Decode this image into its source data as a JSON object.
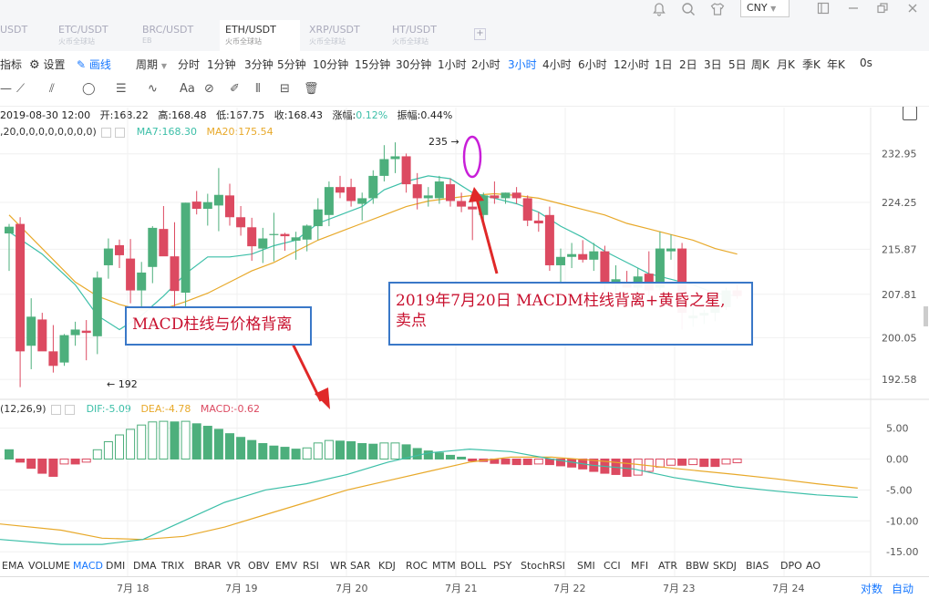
{
  "tabs": [
    {
      "pair": "USDT",
      "sub": "",
      "active": false
    },
    {
      "pair": "ETC/USDT",
      "sub": "火币全球站",
      "active": false
    },
    {
      "pair": "BRC/USDT",
      "sub": "EB",
      "active": false
    },
    {
      "pair": "ETH/USDT",
      "sub": "火币全球站",
      "active": true
    },
    {
      "pair": "XRP/USDT",
      "sub": "火币全球站",
      "active": false
    },
    {
      "pair": "HT/USDT",
      "sub": "火币全球站",
      "active": false
    }
  ],
  "add_tab": "+",
  "currency": "CNY",
  "toolbar": {
    "indicator": "指标",
    "settings": "设置",
    "draw": "画线",
    "period": "周期",
    "intervals": [
      "分时",
      "1分钟",
      "3分钟",
      "5分钟",
      "10分钟",
      "15分钟",
      "30分钟",
      "1小时",
      "2小时",
      "3小时",
      "4小时",
      "6小时",
      "12小时",
      "1日",
      "2日",
      "3日",
      "5日",
      "周K",
      "月K",
      "季K",
      "年K",
      "0s"
    ],
    "active_interval": "3小时"
  },
  "text_tool": "Aa",
  "ohlc": {
    "date": "2019-08-30 12:00",
    "open_label": "开:",
    "open": "168.22",
    "high_label": "高:",
    "high": "168.48",
    "low_label": "低:",
    "low": "167.75",
    "close_label": "收:",
    "close": "168.43",
    "change_label": "涨幅:",
    "change": "0.12%",
    "amp_label": "振幅:",
    "amp": "0.44%"
  },
  "ma_legend": {
    "params": ",20,0,0,0,0,0,0,0,0)",
    "ma7": "MA7:168.30",
    "ma20": "MA20:175.54"
  },
  "macd_legend": {
    "params": "(12,26,9)",
    "dif": "DIF:-5.09",
    "dea": "DEA:-4.78",
    "macd": "MACD:-0.62"
  },
  "indicators": [
    "EMA",
    "VOLUME",
    "MACD",
    "DMI",
    "DMA",
    "TRIX",
    "BRAR",
    "VR",
    "OBV",
    "EMV",
    "RSI",
    "WR",
    "SAR",
    "KDJ",
    "ROC",
    "MTM",
    "BOLL",
    "PSY",
    "StochRSI",
    "SMI",
    "CCI",
    "MFI",
    "ATR",
    "BBW",
    "SKDJ",
    "BIAS",
    "DPO",
    "AO"
  ],
  "active_indicator": "MACD",
  "date_labels": [
    "7月 18",
    "7月 19",
    "7月 20",
    "7月 21",
    "7月 22",
    "7月 23",
    "7月 24"
  ],
  "bottom_right": [
    "对数",
    "自动"
  ],
  "colors": {
    "up": "#4daf7c",
    "down": "#dc4a61",
    "ma7": "#3cbfa8",
    "ma20": "#e8a92a",
    "dif": "#3cbfa8",
    "dea": "#e8a92a",
    "annot": "#c8102e",
    "arrow": "#e02828"
  },
  "chart_data": {
    "type": "candlestick",
    "price_ticks": [
      "232.95",
      "224.25",
      "215.87",
      "207.81",
      "200.05",
      "192.58"
    ],
    "price_ylim": [
      189.5,
      236
    ],
    "macd_ticks": [
      "5.00",
      "0.00",
      "-5.00",
      "-10.00",
      "-15.00"
    ],
    "macd_ylim": [
      -16,
      7
    ],
    "high_marker": "235 →",
    "low_marker": "← 192",
    "candles": [
      {
        "o": 218.7,
        "h": 220.4,
        "l": 212.0,
        "c": 219.9
      },
      {
        "o": 220.4,
        "h": 221.6,
        "l": 191.2,
        "c": 197.6
      },
      {
        "o": 198.6,
        "h": 207.1,
        "l": 194.4,
        "c": 203.8
      },
      {
        "o": 203.3,
        "h": 204.5,
        "l": 197.8,
        "c": 197.6
      },
      {
        "o": 197.6,
        "h": 202.3,
        "l": 193.8,
        "c": 195.0
      },
      {
        "o": 195.6,
        "h": 200.7,
        "l": 195.0,
        "c": 200.5
      },
      {
        "o": 200.5,
        "h": 202.9,
        "l": 198.6,
        "c": 201.5
      },
      {
        "o": 201.3,
        "h": 203.2,
        "l": 196.0,
        "c": 200.9
      },
      {
        "o": 200.3,
        "h": 211.9,
        "l": 197.1,
        "c": 210.8
      },
      {
        "o": 213.0,
        "h": 217.8,
        "l": 210.6,
        "c": 216.0
      },
      {
        "o": 216.6,
        "h": 217.6,
        "l": 212.5,
        "c": 214.8
      },
      {
        "o": 214.2,
        "h": 217.7,
        "l": 206.2,
        "c": 208.5
      },
      {
        "o": 208.5,
        "h": 213.6,
        "l": 205.4,
        "c": 211.7
      },
      {
        "o": 212.7,
        "h": 220.0,
        "l": 209.8,
        "c": 219.7
      },
      {
        "o": 219.5,
        "h": 223.6,
        "l": 216.6,
        "c": 214.6
      },
      {
        "o": 214.6,
        "h": 220.7,
        "l": 205.6,
        "c": 208.4
      },
      {
        "o": 208.1,
        "h": 224.2,
        "l": 205.3,
        "c": 224.2
      },
      {
        "o": 224.4,
        "h": 226.3,
        "l": 222.1,
        "c": 223.1
      },
      {
        "o": 223.1,
        "h": 225.8,
        "l": 220.1,
        "c": 224.3
      },
      {
        "o": 223.7,
        "h": 230.4,
        "l": 219.1,
        "c": 225.6
      },
      {
        "o": 225.5,
        "h": 227.6,
        "l": 220.1,
        "c": 221.6
      },
      {
        "o": 221.6,
        "h": 223.6,
        "l": 218.3,
        "c": 219.8
      },
      {
        "o": 219.8,
        "h": 221.5,
        "l": 213.8,
        "c": 216.4
      },
      {
        "o": 216.0,
        "h": 219.7,
        "l": 213.4,
        "c": 217.8
      },
      {
        "o": 218.4,
        "h": 222.4,
        "l": 213.7,
        "c": 218.6
      },
      {
        "o": 218.6,
        "h": 218.8,
        "l": 215.6,
        "c": 218.2
      },
      {
        "o": 217.4,
        "h": 219.0,
        "l": 214.0,
        "c": 218.0
      },
      {
        "o": 217.6,
        "h": 220.3,
        "l": 215.5,
        "c": 220.1
      },
      {
        "o": 220.0,
        "h": 225.0,
        "l": 217.5,
        "c": 223.0
      },
      {
        "o": 222.0,
        "h": 228.0,
        "l": 220.0,
        "c": 227.0
      },
      {
        "o": 227.0,
        "h": 229.0,
        "l": 225.0,
        "c": 226.0
      },
      {
        "o": 227.0,
        "h": 228.5,
        "l": 223.5,
        "c": 224.5
      },
      {
        "o": 224.0,
        "h": 226.0,
        "l": 221.0,
        "c": 225.0
      },
      {
        "o": 225.0,
        "h": 230.0,
        "l": 224.0,
        "c": 229.0
      },
      {
        "o": 229.0,
        "h": 234.5,
        "l": 228.0,
        "c": 232.0
      },
      {
        "o": 232.0,
        "h": 235.0,
        "l": 229.5,
        "c": 232.5
      },
      {
        "o": 232.5,
        "h": 233.0,
        "l": 226.0,
        "c": 227.5
      },
      {
        "o": 227.5,
        "h": 229.5,
        "l": 223.0,
        "c": 225.0
      },
      {
        "o": 225.0,
        "h": 227.0,
        "l": 223.5,
        "c": 225.5
      },
      {
        "o": 225.0,
        "h": 229.0,
        "l": 224.0,
        "c": 228.0
      },
      {
        "o": 227.5,
        "h": 228.5,
        "l": 223.5,
        "c": 224.5
      },
      {
        "o": 224.5,
        "h": 226.0,
        "l": 222.5,
        "c": 223.5
      },
      {
        "o": 223.5,
        "h": 224.5,
        "l": 217.5,
        "c": 223.0
      },
      {
        "o": 222.0,
        "h": 226.0,
        "l": 220.5,
        "c": 225.5
      },
      {
        "o": 225.5,
        "h": 228.0,
        "l": 224.0,
        "c": 225.0
      },
      {
        "o": 225.0,
        "h": 226.0,
        "l": 224.0,
        "c": 226.0
      },
      {
        "o": 226.0,
        "h": 227.0,
        "l": 224.0,
        "c": 225.0
      },
      {
        "o": 225.0,
        "h": 225.5,
        "l": 220.0,
        "c": 221.0
      },
      {
        "o": 221.0,
        "h": 222.5,
        "l": 219.0,
        "c": 220.5
      },
      {
        "o": 222.0,
        "h": 223.5,
        "l": 212.0,
        "c": 213.0
      },
      {
        "o": 213.0,
        "h": 216.0,
        "l": 210.0,
        "c": 214.5
      },
      {
        "o": 214.5,
        "h": 217.0,
        "l": 212.5,
        "c": 215.0
      },
      {
        "o": 215.0,
        "h": 217.5,
        "l": 213.5,
        "c": 214.0
      },
      {
        "o": 214.0,
        "h": 217.0,
        "l": 212.0,
        "c": 215.5
      },
      {
        "o": 215.5,
        "h": 216.5,
        "l": 208.0,
        "c": 209.5
      },
      {
        "o": 209.5,
        "h": 213.0,
        "l": 207.5,
        "c": 210.5
      },
      {
        "o": 210.0,
        "h": 212.0,
        "l": 209.0,
        "c": 209.0
      },
      {
        "o": 209.0,
        "h": 212.5,
        "l": 208.0,
        "c": 211.0
      },
      {
        "o": 211.5,
        "h": 215.5,
        "l": 207.5,
        "c": 208.5
      },
      {
        "o": 209.0,
        "h": 219.0,
        "l": 208.5,
        "c": 216.0
      },
      {
        "o": 215.5,
        "h": 218.5,
        "l": 214.0,
        "c": 216.0
      },
      {
        "o": 216.0,
        "h": 217.0,
        "l": 201.5,
        "c": 204.5
      },
      {
        "o": 203.5,
        "h": 206.0,
        "l": 202.0,
        "c": 204.0
      },
      {
        "o": 204.0,
        "h": 205.0,
        "l": 202.5,
        "c": 204.5
      },
      {
        "o": 204.5,
        "h": 207.0,
        "l": 203.0,
        "c": 206.0
      },
      {
        "o": 205.5,
        "h": 209.0,
        "l": 205.0,
        "c": 208.5
      },
      {
        "o": 208.5,
        "h": 209.5,
        "l": 207.0,
        "c": 207.5
      }
    ],
    "ma7": [
      [
        0,
        219
      ],
      [
        3,
        215
      ],
      [
        6,
        209.5
      ],
      [
        8,
        204
      ],
      [
        10,
        201.5
      ],
      [
        12,
        204
      ],
      [
        14,
        207.5
      ],
      [
        16,
        211.5
      ],
      [
        18,
        214.5
      ],
      [
        20,
        214.5
      ],
      [
        22,
        215
      ],
      [
        24,
        216.5
      ],
      [
        26,
        217.5
      ],
      [
        28,
        220.5
      ],
      [
        30,
        222
      ],
      [
        32,
        223.5
      ],
      [
        34,
        226.5
      ],
      [
        36,
        228
      ],
      [
        38,
        229
      ],
      [
        40,
        228.5
      ],
      [
        42,
        226
      ],
      [
        44,
        225
      ],
      [
        46,
        224
      ],
      [
        48,
        222.5
      ],
      [
        50,
        220
      ],
      [
        52,
        218
      ],
      [
        54,
        215.5
      ],
      [
        56,
        213.5
      ],
      [
        58,
        211.5
      ],
      [
        60,
        210.5
      ],
      [
        62,
        209.5
      ],
      [
        64,
        208
      ],
      [
        66,
        207.5
      ]
    ],
    "ma20": [
      [
        0,
        222
      ],
      [
        2,
        218
      ],
      [
        4,
        214
      ],
      [
        6,
        210
      ],
      [
        8,
        207.5
      ],
      [
        10,
        206
      ],
      [
        12,
        205
      ],
      [
        14,
        205.2
      ],
      [
        16,
        206.5
      ],
      [
        18,
        208
      ],
      [
        20,
        210
      ],
      [
        22,
        212
      ],
      [
        24,
        213.5
      ],
      [
        26,
        215.5
      ],
      [
        28,
        217.5
      ],
      [
        30,
        219
      ],
      [
        32,
        220.5
      ],
      [
        34,
        222
      ],
      [
        36,
        223.5
      ],
      [
        38,
        224.5
      ],
      [
        40,
        225
      ],
      [
        42,
        225.5
      ],
      [
        44,
        225.8
      ],
      [
        46,
        225.5
      ],
      [
        48,
        225
      ],
      [
        50,
        224
      ],
      [
        52,
        223
      ],
      [
        54,
        222
      ],
      [
        56,
        220.5
      ],
      [
        58,
        219.5
      ],
      [
        60,
        218.5
      ],
      [
        62,
        217.5
      ],
      [
        64,
        216
      ],
      [
        66,
        215
      ]
    ],
    "macd_hist": [
      1.5,
      -0.5,
      -1.5,
      -2.3,
      -2.8,
      -0.8,
      -0.8,
      -0.5,
      1.5,
      2.8,
      3.9,
      4.8,
      5.5,
      6.0,
      6.1,
      6.0,
      6.1,
      5.7,
      5.3,
      4.8,
      4.1,
      3.5,
      3.0,
      2.5,
      2.1,
      1.9,
      1.6,
      1.8,
      2.6,
      3.0,
      2.9,
      2.8,
      2.5,
      2.4,
      2.6,
      2.6,
      2.3,
      1.7,
      1.3,
      1.0,
      0.6,
      0.3,
      -0.3,
      -0.4,
      -0.7,
      -0.8,
      -0.9,
      -0.9,
      -0.8,
      -0.9,
      -1.1,
      -1.3,
      -1.6,
      -2.0,
      -2.3,
      -2.5,
      -2.8,
      -2.6,
      -2.0,
      -1.3,
      -1.0,
      -1.0,
      -0.9,
      -1.2,
      -1.2,
      -0.8,
      -0.6
    ],
    "dif": [
      [
        0,
        -13
      ],
      [
        6,
        -13.8
      ],
      [
        10,
        -13.8
      ],
      [
        14,
        -13
      ],
      [
        18,
        -10
      ],
      [
        22,
        -7
      ],
      [
        26,
        -5
      ],
      [
        30,
        -4
      ],
      [
        34,
        -2.5
      ],
      [
        38,
        -0.5
      ],
      [
        42,
        1
      ],
      [
        46,
        1.6
      ],
      [
        50,
        1.2
      ],
      [
        54,
        0
      ],
      [
        58,
        -1
      ],
      [
        62,
        -1.6
      ],
      [
        66,
        -3
      ],
      [
        72,
        -4.5
      ],
      [
        76,
        -5.2
      ],
      [
        80,
        -5.8
      ],
      [
        84,
        -6.2
      ]
    ],
    "dea": [
      [
        0,
        -10.5
      ],
      [
        6,
        -11.5
      ],
      [
        10,
        -12.8
      ],
      [
        14,
        -13
      ],
      [
        18,
        -12.5
      ],
      [
        22,
        -11
      ],
      [
        26,
        -9
      ],
      [
        30,
        -7
      ],
      [
        34,
        -5
      ],
      [
        38,
        -3.5
      ],
      [
        42,
        -2
      ],
      [
        46,
        -0.5
      ],
      [
        50,
        0.3
      ],
      [
        54,
        0.3
      ],
      [
        58,
        -0.2
      ],
      [
        62,
        -0.8
      ],
      [
        66,
        -1.5
      ],
      [
        72,
        -2.5
      ],
      [
        76,
        -3.2
      ],
      [
        80,
        -4
      ],
      [
        84,
        -4.7
      ]
    ]
  },
  "annotations": {
    "left": "MACD柱线与价格背离",
    "right_line1": "2019年7月20日 MACDM柱线背离+黄昏之星,",
    "right_line2": "卖点"
  }
}
